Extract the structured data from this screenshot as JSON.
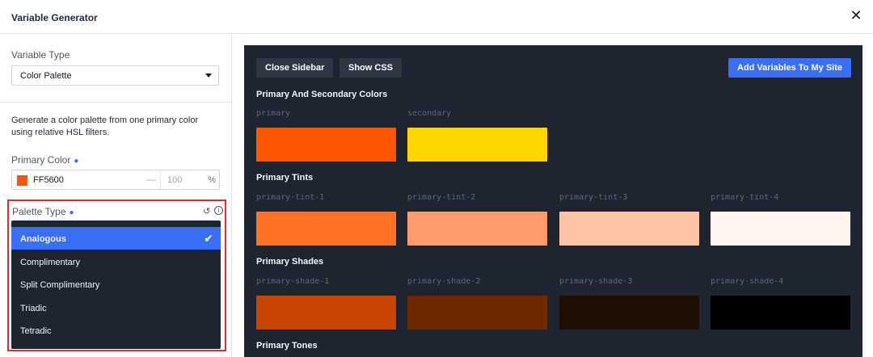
{
  "header": {
    "title": "Variable Generator"
  },
  "sidebar": {
    "variable_type_label": "Variable Type",
    "variable_type_value": "Color Palette",
    "description": "Generate a color palette from one primary color using relative HSL filters.",
    "primary_color_label": "Primary Color",
    "primary_color_hex": "FF5600",
    "primary_color_swatch": "#ff5600",
    "opacity_dash": "—",
    "opacity_value": "100",
    "opacity_unit": "%",
    "palette_type_label": "Palette Type",
    "palette_options": [
      {
        "label": "Analogous",
        "selected": true
      },
      {
        "label": "Complimentary",
        "selected": false
      },
      {
        "label": "Split Complimentary",
        "selected": false
      },
      {
        "label": "Triadic",
        "selected": false
      },
      {
        "label": "Tetradic",
        "selected": false
      }
    ]
  },
  "toolbar": {
    "close_sidebar": "Close Sidebar",
    "show_css": "Show CSS",
    "add_variables": "Add Variables To My Site"
  },
  "sections": [
    {
      "title": "Primary And Secondary Colors",
      "swatches": [
        {
          "name": "primary",
          "color": "#ff5600"
        },
        {
          "name": "secondary",
          "color": "#fdd600"
        }
      ]
    },
    {
      "title": "Primary Tints",
      "swatches": [
        {
          "name": "primary-tint-1",
          "color": "#ff7127"
        },
        {
          "name": "primary-tint-2",
          "color": "#ff9b6b"
        },
        {
          "name": "primary-tint-3",
          "color": "#ffc4a6"
        },
        {
          "name": "primary-tint-4",
          "color": "#fff4ee"
        }
      ]
    },
    {
      "title": "Primary Shades",
      "swatches": [
        {
          "name": "primary-shade-1",
          "color": "#c84400"
        },
        {
          "name": "primary-shade-2",
          "color": "#6f2800"
        },
        {
          "name": "primary-shade-3",
          "color": "#1f0e02"
        },
        {
          "name": "primary-shade-4",
          "color": "#000000"
        }
      ]
    },
    {
      "title": "Primary Tones",
      "swatches": []
    }
  ]
}
